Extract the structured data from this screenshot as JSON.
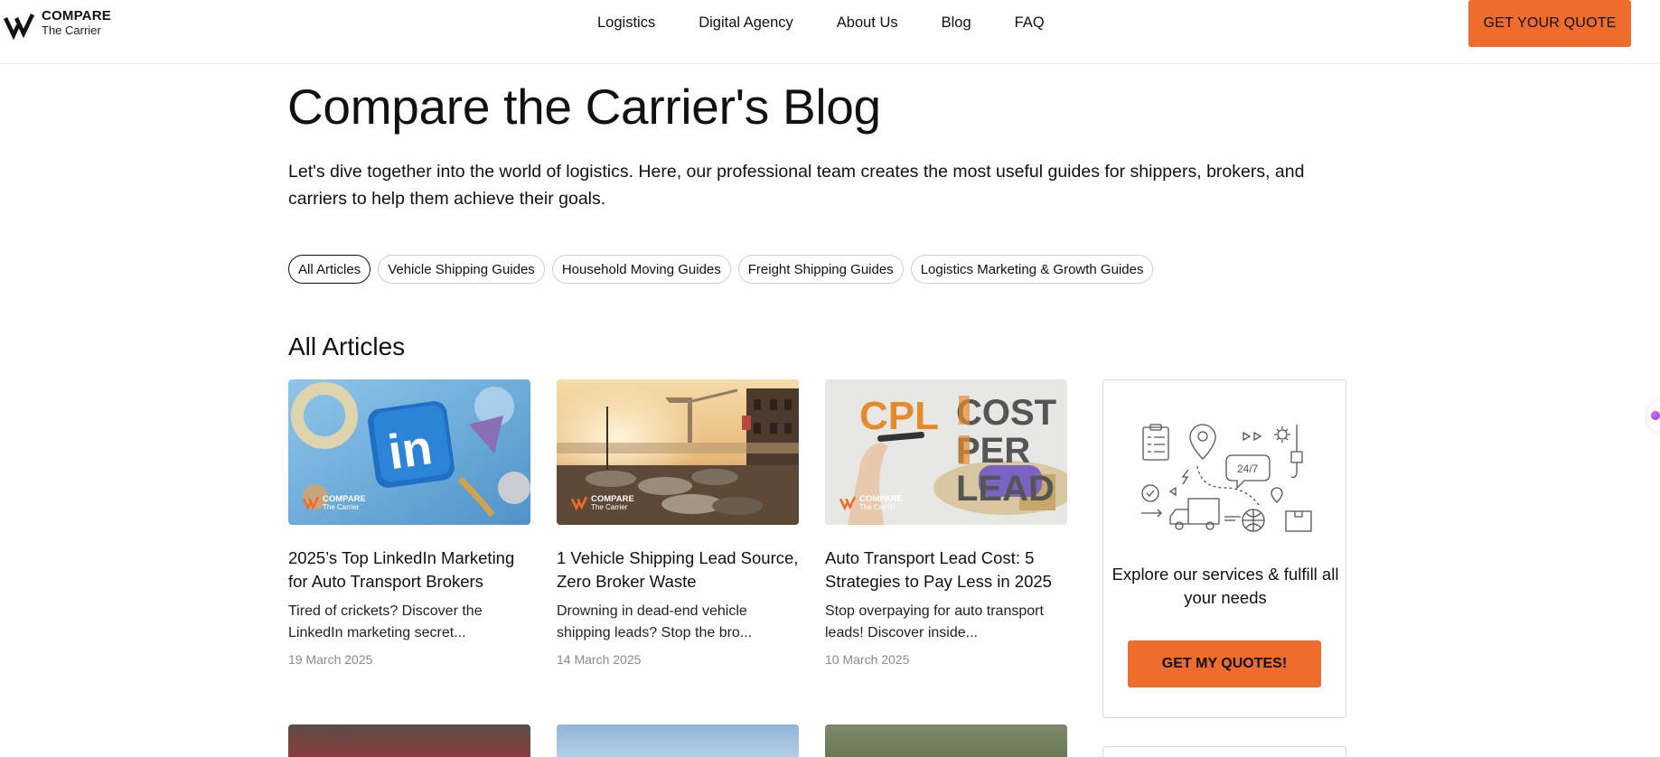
{
  "header": {
    "logo": {
      "brand": "COMPARE",
      "sub": "The Carrier",
      "icon": "compare-carrier-logo-mark"
    },
    "nav": [
      {
        "label": "Logistics"
      },
      {
        "label": "Digital Agency"
      },
      {
        "label": "About Us"
      },
      {
        "label": "Blog"
      },
      {
        "label": "FAQ"
      }
    ],
    "cta": "GET YOUR QUOTE"
  },
  "hero": {
    "title": "Compare the Carrier's Blog",
    "intro": "Let's dive together into the world of logistics. Here, our professional team creates the most useful guides for shippers, brokers, and carriers to help them achieve their goals."
  },
  "filters": [
    {
      "label": "All Articles",
      "active": true
    },
    {
      "label": "Vehicle Shipping Guides",
      "active": false
    },
    {
      "label": "Household Moving Guides",
      "active": false
    },
    {
      "label": "Freight Shipping Guides",
      "active": false
    },
    {
      "label": "Logistics Marketing & Growth Guides",
      "active": false
    }
  ],
  "section_title": "All Articles",
  "image_badge": {
    "brand": "COMPARE",
    "sub": "The Carrier"
  },
  "articles": [
    {
      "title": "2025’s Top LinkedIn Marketing for Auto Transport Brokers",
      "excerpt": "Tired of crickets? Discover the LinkedIn marketing secret...",
      "date": "19 March 2025",
      "image": "linkedin-logo-3d"
    },
    {
      "title": "1 Vehicle Shipping Lead Source, Zero Broker Waste",
      "excerpt": "Drowning in dead-end vehicle shipping leads? Stop the bro...",
      "date": "14 March 2025",
      "image": "port-parking-lot-sunset"
    },
    {
      "title": "Auto Transport Lead Cost: 5 Strategies to Pay Less in 2025",
      "excerpt": "Stop overpaying for auto transport leads! Discover inside...",
      "date": "10 March 2025",
      "image": "cpl-cost-per-lead",
      "image_text": {
        "abbr": "CPL",
        "words": [
          "COST",
          "PER",
          "LEAD"
        ]
      }
    }
  ],
  "sidebar": {
    "promo_text": "Explore our services & fulfill all your needs",
    "promo_button": "GET MY QUOTES!",
    "illustration": "logistics-line-icons",
    "illustration_label": "24/7"
  },
  "colors": {
    "accent": "#ee6c2d",
    "text": "#111111",
    "muted": "#8a8a8a",
    "border": "#d9d9d9"
  }
}
